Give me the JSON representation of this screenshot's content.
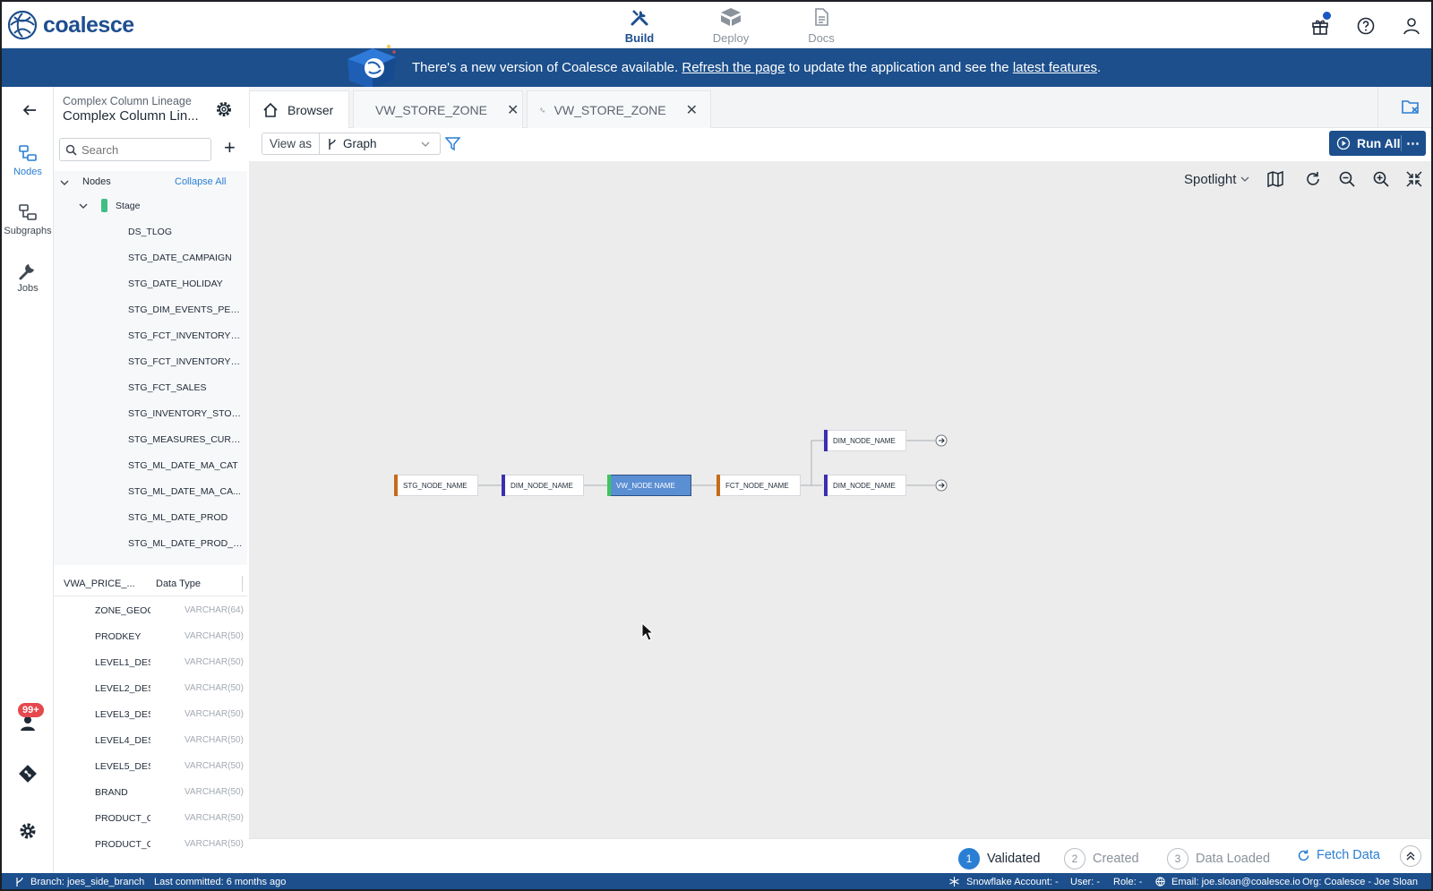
{
  "app": {
    "logo_text": "coalesce"
  },
  "topnav": {
    "build_label": "Build",
    "deploy_label": "Deploy",
    "docs_label": "Docs"
  },
  "banner": {
    "text_before": "There's a new version of Coalesce available. ",
    "refresh_link": "Refresh the page",
    "text_middle": " to update the application and see the ",
    "features_link": "latest features",
    "text_after": "."
  },
  "rail": {
    "nodes_label": "Nodes",
    "subgraphs_label": "Subgraphs",
    "jobs_label": "Jobs",
    "notifications_badge": "99+"
  },
  "project": {
    "subtitle": "Complex Column Lineage",
    "title": "Complex Column Lin..."
  },
  "search": {
    "placeholder": "Search"
  },
  "tree": {
    "nodes_label": "Nodes",
    "collapse_all": "Collapse All",
    "stage_label": "Stage",
    "items": [
      "DS_TLOG",
      "STG_DATE_CAMPAIGN",
      "STG_DATE_HOLIDAY",
      "STG_DIM_EVENTS_PERI...",
      "STG_FCT_INVENTORY_...",
      "STG_FCT_INVENTORY_...",
      "STG_FCT_SALES",
      "STG_INVENTORY_STOR...",
      "STG_MEASURES_CURR...",
      "STG_ML_DATE_MA_CAT",
      "STG_ML_DATE_MA_CA...",
      "STG_ML_DATE_PROD",
      "STG_ML_DATE_PROD_S..."
    ]
  },
  "columns": {
    "header_name": "VWA_PRICE_...",
    "header_type": "Data Type",
    "rows": [
      {
        "name": "ZONE_GEOGI",
        "type": "VARCHAR(64)"
      },
      {
        "name": "PRODKEY",
        "type": "VARCHAR(50)"
      },
      {
        "name": "LEVEL1_DES",
        "type": "VARCHAR(50)"
      },
      {
        "name": "LEVEL2_DES",
        "type": "VARCHAR(50)"
      },
      {
        "name": "LEVEL3_DES",
        "type": "VARCHAR(50)"
      },
      {
        "name": "LEVEL4_DES",
        "type": "VARCHAR(50)"
      },
      {
        "name": "LEVEL5_DES",
        "type": "VARCHAR(50)"
      },
      {
        "name": "BRAND",
        "type": "VARCHAR(50)"
      },
      {
        "name": "PRODUCT_GI",
        "type": "VARCHAR(50)"
      },
      {
        "name": "PRODUCT_GI",
        "type": "VARCHAR(50)"
      }
    ]
  },
  "tabs": [
    {
      "label": "Browser",
      "icon": "home-icon"
    },
    {
      "label": "VW_STORE_ZONE",
      "icon": "node-bar-icon"
    },
    {
      "label": "VW_STORE_ZONE",
      "icon": "lineage-icon"
    }
  ],
  "toolbar": {
    "view_as_label": "View as",
    "view_mode": "Graph",
    "run_all_label": "Run All",
    "more_label": "⋯"
  },
  "graph": {
    "spotlight_label": "Spotlight",
    "nodes": [
      {
        "label": "STG_NODE_NAME",
        "color": "#c76a1a"
      },
      {
        "label": "DIM_NODE_NAME",
        "color": "#3b2fb0"
      },
      {
        "label": "VW_NODE NAME",
        "color": "#3fc65a"
      },
      {
        "label": "FCT_NODE_NAME",
        "color": "#c76a1a"
      },
      {
        "label": "DIM_NODE_NAME",
        "color": "#3b2fb0"
      },
      {
        "label": "DIM_NODE_NAME",
        "color": "#3b2fb0"
      }
    ]
  },
  "steps": {
    "validated": {
      "num": "1",
      "label": "Validated"
    },
    "created": {
      "num": "2",
      "label": "Created"
    },
    "data_loaded": {
      "num": "3",
      "label": "Data Loaded"
    },
    "fetch_label": "Fetch Data"
  },
  "footer": {
    "branch": "Branch: joes_side_branch",
    "committed": "Last committed: 6 months ago",
    "snowflake": "Snowflake Account: -",
    "user": "User: -",
    "role": "Role: -",
    "email": "Email: joe.sloan@coalesce.io",
    "org": "Org: Coalesce - Joe Sloan"
  },
  "colors": {
    "brand": "#1c4f8c",
    "accent": "#2a7fd4",
    "badge": "#e5484d"
  }
}
